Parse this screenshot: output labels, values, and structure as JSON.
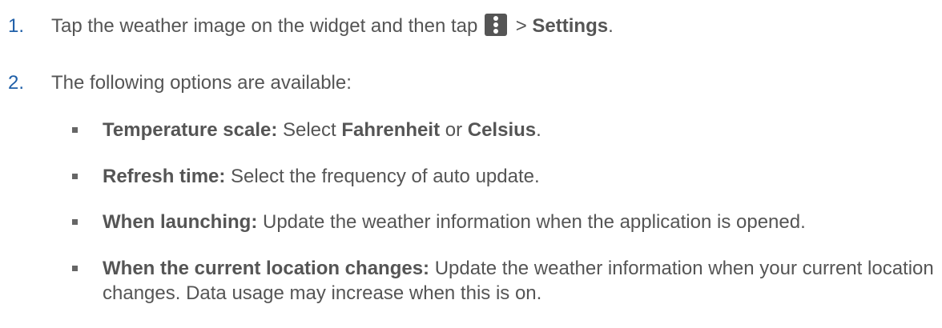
{
  "steps": [
    {
      "number": "1.",
      "text_before": "Tap the weather image on the widget and then tap",
      "icon": "more-vert-icon",
      "text_mid": " > ",
      "bold": "Settings",
      "text_after": "."
    },
    {
      "number": "2.",
      "text": "The following options are available:"
    }
  ],
  "options": [
    {
      "label": "Temperature scale:",
      "parts": [
        " Select ",
        "Fahrenheit",
        " or ",
        "Celsius",
        "."
      ]
    },
    {
      "label": "Refresh time:",
      "text": " Select the frequency of auto update."
    },
    {
      "label": "When launching:",
      "text": " Update the weather information when the application is opened."
    },
    {
      "label": "When the current location changes:",
      "text": " Update the weather information when your current location changes. Data usage may increase when this is on."
    }
  ]
}
